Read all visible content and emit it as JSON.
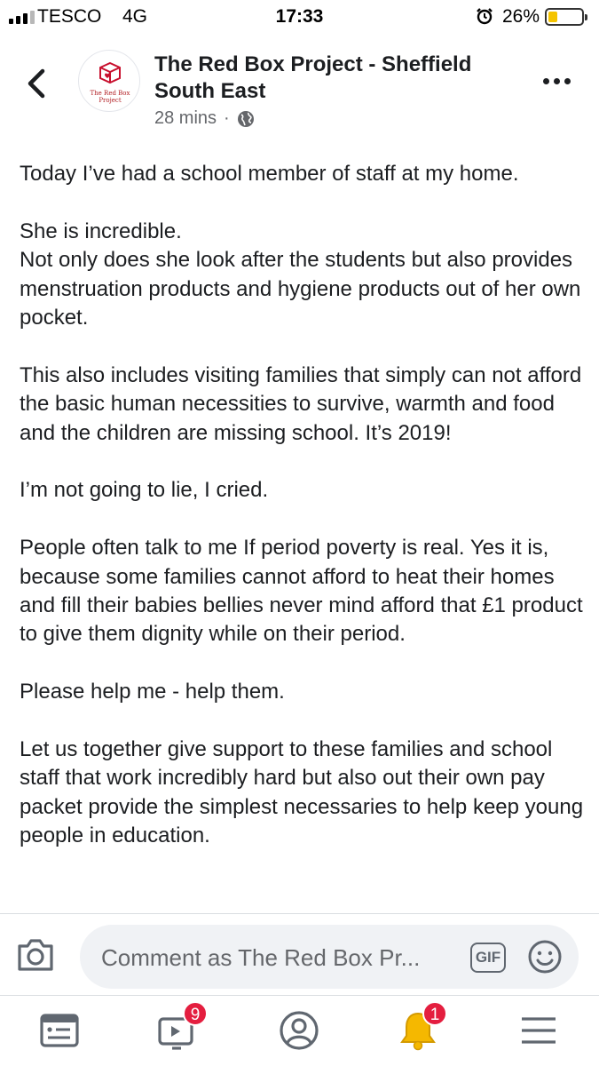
{
  "status_bar": {
    "carrier": "TESCO",
    "network": "4G",
    "time": "17:33",
    "battery_percent": "26%",
    "battery_level": 0.26
  },
  "header": {
    "page_name": "The Red Box Project - Sheffield South East",
    "time_ago": "28 mins",
    "separator": "·",
    "avatar_text": "The Red Box Project"
  },
  "post": {
    "paragraphs": [
      "Today I’ve had a school member of staff at my home.",
      "She is incredible.\nNot only does she look after the students but also provides menstruation products and hygiene products out of her own pocket.",
      "This also includes visiting families that simply can not afford the basic human necessities to survive, warmth and food and the children are missing school. It’s 2019!",
      "I’m not going to lie, I cried.",
      "People often talk to me If period poverty is real. Yes it is, because some families cannot afford to heat their homes and fill their babies bellies never mind afford that £1 product to give them dignity while on their period.",
      "Please help me - help them.",
      "Let us together give support to these families and school staff that work incredibly hard but also out their own pay packet provide the simplest necessaries to help keep young people in education."
    ]
  },
  "comment_bar": {
    "placeholder": "Comment as The Red Box Pr...",
    "gif_label": "GIF"
  },
  "bottom_nav": {
    "video_badge": "9",
    "notifications_badge": "1"
  },
  "icons": {
    "back": "chevron-left-icon",
    "more": "more-dots-icon",
    "globe": "globe-icon",
    "camera": "camera-icon",
    "smile": "smile-icon",
    "feed": "news-feed-icon",
    "watch": "watch-video-icon",
    "profile": "profile-icon",
    "notifications": "bell-icon",
    "menu": "menu-icon"
  },
  "colors": {
    "brand_red": "#c8102e",
    "badge_red": "#e41e3f",
    "battery_yellow": "#f5c400",
    "bell_yellow": "#f5b800"
  }
}
